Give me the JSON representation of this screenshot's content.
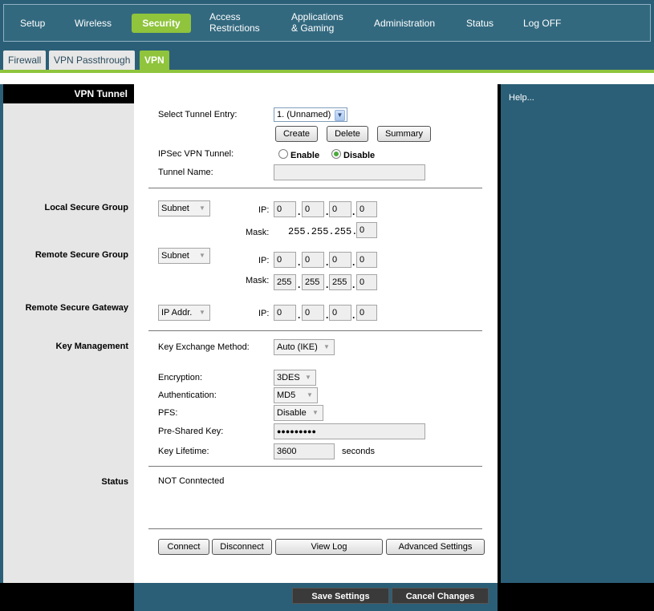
{
  "nav": {
    "items": [
      {
        "label": "Setup"
      },
      {
        "label": "Wireless"
      },
      {
        "label": "Security"
      },
      {
        "label": "Access Restrictions"
      },
      {
        "label": "Applications & Gaming"
      },
      {
        "label": "Administration"
      },
      {
        "label": "Status"
      },
      {
        "label": "Log OFF"
      }
    ],
    "active": "Security"
  },
  "subtabs": [
    {
      "label": "Firewall"
    },
    {
      "label": "VPN Passthrough"
    },
    {
      "label": "VPN"
    }
  ],
  "left": {
    "header": "VPN Tunnel",
    "sections": {
      "local": "Local Secure Group",
      "remote": "Remote Secure Group",
      "gateway": "Remote Secure Gateway",
      "key": "Key Management",
      "status": "Status"
    }
  },
  "help": {
    "label": "Help..."
  },
  "tunnel": {
    "select_label": "Select Tunnel Entry:",
    "select_value": "1. (Unnamed)",
    "create": "Create",
    "delete": "Delete",
    "summary": "Summary",
    "ipsec_label": "IPSec VPN Tunnel:",
    "enable": "Enable",
    "disable": "Disable",
    "ipsec_selected": "Disable",
    "name_label": "Tunnel Name:",
    "name_value": ""
  },
  "local_group": {
    "type": "Subnet",
    "ip_label": "IP:",
    "ip": [
      "0",
      "0",
      "0",
      "0"
    ],
    "mask_label": "Mask:",
    "mask_fixed": "255.255.255.",
    "mask_last": "0"
  },
  "remote_group": {
    "type": "Subnet",
    "ip_label": "IP:",
    "ip": [
      "0",
      "0",
      "0",
      "0"
    ],
    "mask_label": "Mask:",
    "mask": [
      "255",
      "255",
      "255",
      "0"
    ]
  },
  "gateway": {
    "type": "IP Addr.",
    "ip_label": "IP:",
    "ip": [
      "0",
      "0",
      "0",
      "0"
    ]
  },
  "key_mgmt": {
    "method_label": "Key Exchange Method:",
    "method": "Auto (IKE)",
    "encryption_label": "Encryption:",
    "encryption": "3DES",
    "auth_label": "Authentication:",
    "auth": "MD5",
    "pfs_label": "PFS:",
    "pfs": "Disable",
    "psk_label": "Pre-Shared Key:",
    "psk": "●●●●●●●●●",
    "lifetime_label": "Key Lifetime:",
    "lifetime": "3600",
    "lifetime_unit": "seconds"
  },
  "status": {
    "value": "NOT Conntected"
  },
  "actions": {
    "connect": "Connect",
    "disconnect": "Disconnect",
    "view_log": "View Log",
    "advanced": "Advanced Settings"
  },
  "footer": {
    "save": "Save Settings",
    "cancel": "Cancel Changes"
  },
  "colors": {
    "accent": "#8fc43c",
    "background": "#2b5f77"
  }
}
